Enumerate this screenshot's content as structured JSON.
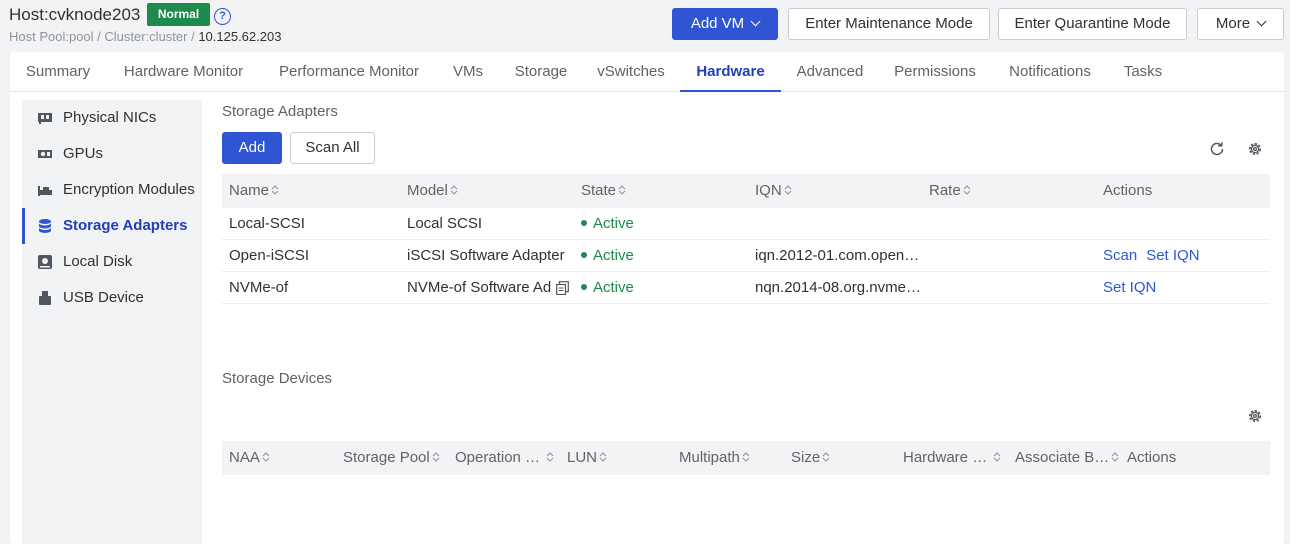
{
  "header": {
    "host_title": "Host:cvknode203",
    "status_badge": "Normal",
    "help_glyph": "?",
    "breadcrumb_path": "Host Pool:pool / Cluster:cluster / ",
    "breadcrumb_ip": "10.125.62.203",
    "buttons": {
      "add_vm": "Add VM",
      "maintenance": "Enter Maintenance Mode",
      "quarantine": "Enter Quarantine Mode",
      "more": "More"
    }
  },
  "tabs": [
    "Summary",
    "Hardware Monitor",
    "Performance Monitor",
    "VMs",
    "Storage",
    "vSwitches",
    "Hardware",
    "Advanced",
    "Permissions",
    "Notifications",
    "Tasks"
  ],
  "active_tab": "Hardware",
  "sidebar": {
    "items": [
      {
        "label": "Physical NICs",
        "icon": "nic-icon"
      },
      {
        "label": "GPUs",
        "icon": "gpu-icon"
      },
      {
        "label": "Encryption Modules",
        "icon": "encryption-icon"
      },
      {
        "label": "Storage Adapters",
        "icon": "database-icon"
      },
      {
        "label": "Local Disk",
        "icon": "disk-icon"
      },
      {
        "label": "USB Device",
        "icon": "usb-icon"
      }
    ],
    "active": "Storage Adapters"
  },
  "adapters": {
    "title": "Storage Adapters",
    "add_label": "Add",
    "scan_all_label": "Scan All",
    "columns": [
      "Name",
      "Model",
      "State",
      "IQN",
      "Rate",
      "Actions"
    ],
    "rows": [
      {
        "name": "Local-SCSI",
        "model": "Local SCSI",
        "state": "Active",
        "iqn": "",
        "rate": "",
        "actions": []
      },
      {
        "name": "Open-iSCSI",
        "model": "iSCSI Software Adapter",
        "state": "Active",
        "iqn": "iqn.2012-01.com.open…",
        "rate": "",
        "actions": [
          "Scan",
          "Set IQN"
        ]
      },
      {
        "name": "NVMe-of",
        "model": "NVMe-of Software Ad",
        "state": "Active",
        "iqn": "nqn.2014-08.org.nvme…",
        "rate": "",
        "actions": [
          "Set IQN"
        ]
      }
    ]
  },
  "devices": {
    "title": "Storage Devices",
    "columns": [
      "NAA",
      "Storage Pool",
      "Operation …",
      "LUN",
      "Multipath",
      "Size",
      "Hardware …",
      "Associate B…",
      "Actions"
    ]
  },
  "colors": {
    "primary": "#2f55d4",
    "active_green": "#1e8a4c"
  }
}
